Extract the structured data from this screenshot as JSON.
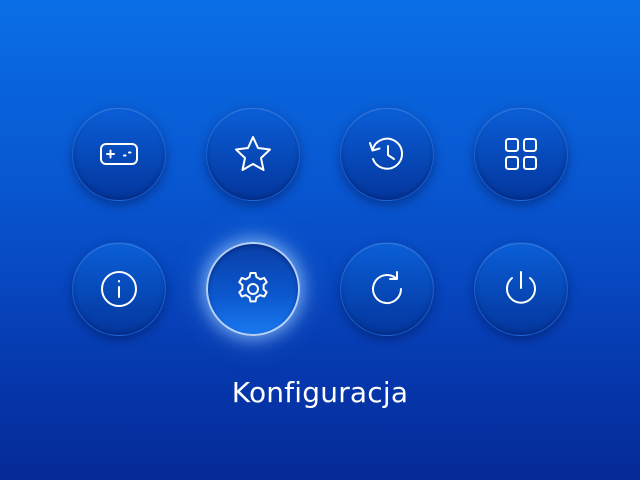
{
  "menu": {
    "items": [
      {
        "id": "games",
        "icon": "gamepad-icon"
      },
      {
        "id": "favorites",
        "icon": "star-icon"
      },
      {
        "id": "history",
        "icon": "history-icon"
      },
      {
        "id": "apps",
        "icon": "grid-icon"
      },
      {
        "id": "info",
        "icon": "info-icon"
      },
      {
        "id": "settings",
        "icon": "gear-icon",
        "selected": true
      },
      {
        "id": "refresh",
        "icon": "refresh-icon"
      },
      {
        "id": "power",
        "icon": "power-icon"
      }
    ],
    "selected_label": "Konfiguracja"
  },
  "colors": {
    "background_top": "#0a6fe6",
    "background_bottom": "#052a96",
    "icon": "#ffffff",
    "selected_glow": "#a0cdff"
  }
}
